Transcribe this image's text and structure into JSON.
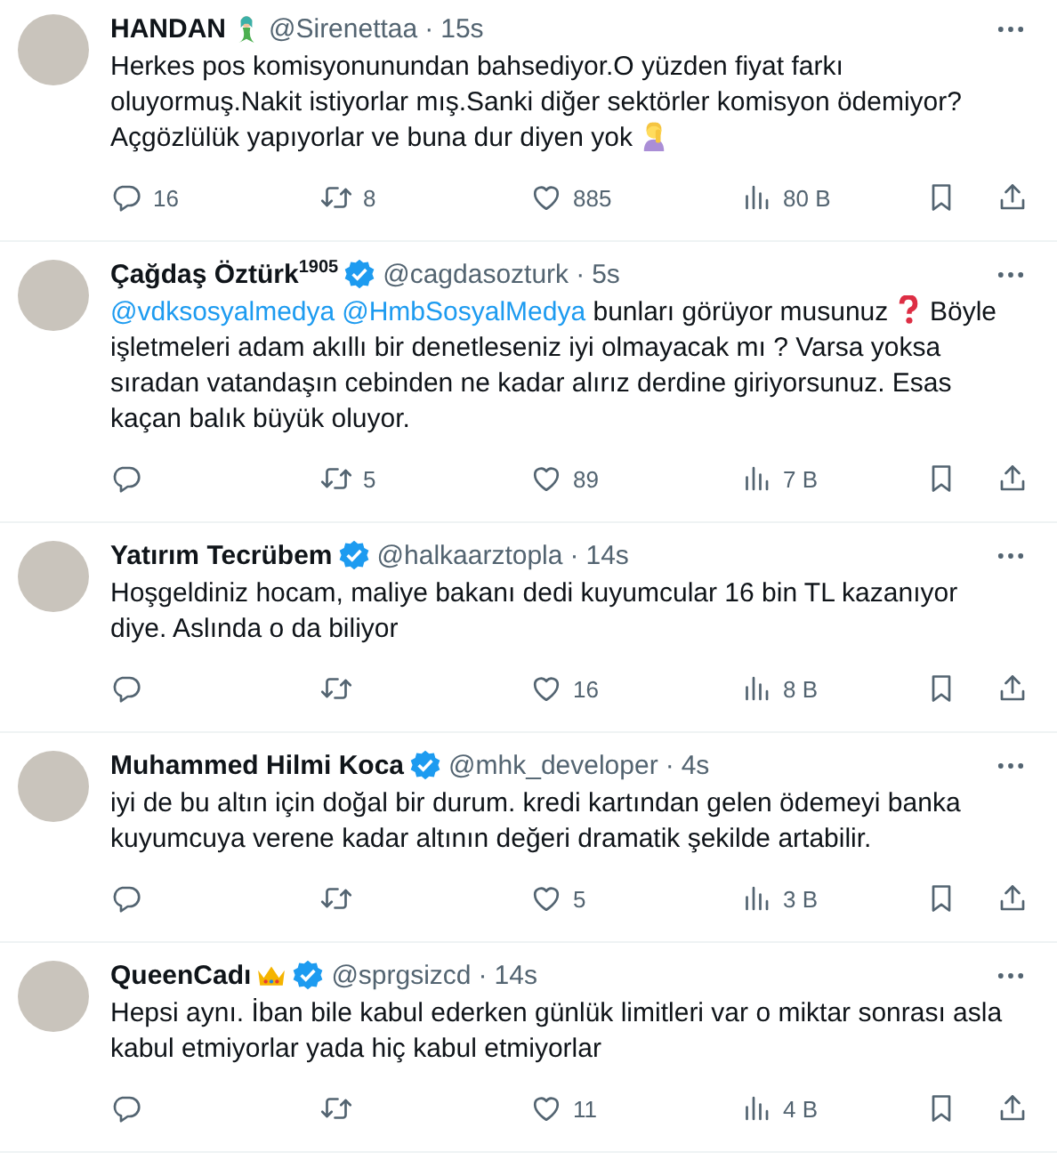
{
  "tweets": [
    {
      "name": "HANDAN",
      "name_emoji": {
        "kind": "mermaid"
      },
      "verified": false,
      "handle": "@Sirenettaa",
      "separator": "·",
      "time": "15s",
      "body": [
        {
          "kind": "text",
          "text": "Herkes pos komisyonunundan bahsediyor.O yüzden fiyat farkı oluyormuş.Nakit istiyorlar mış.Sanki diğer sektörler komisyon ödemiyor? Açgözlülük yapıyorlar ve buna dur diyen yok "
        },
        {
          "kind": "person-emoji"
        }
      ],
      "replies": "16",
      "reposts": "8",
      "likes": "885",
      "views": "80 B"
    },
    {
      "name": "Çağdaş Öztürk$^{1905}$",
      "verified": true,
      "handle": "@cagdasozturk",
      "separator": "·",
      "time": "5s",
      "body": [
        {
          "kind": "mention",
          "text": "@vdksosyalmedya"
        },
        {
          "kind": "mention",
          "text": "@HmbSosyalMedya"
        },
        {
          "kind": "text",
          "text": "  bunları görüyor musunuz "
        },
        {
          "kind": "question-emoji"
        },
        {
          "kind": "text",
          "text": " Böyle işletmeleri adam akıllı bir denetleseniz iyi olmayacak mı ? Varsa yoksa sıradan vatandaşın cebinden ne kadar alırız derdine giriyorsunuz. Esas kaçan balık büyük oluyor."
        }
      ],
      "reposts": "5",
      "likes": "89",
      "views": "7 B"
    },
    {
      "name": "Yatırım Tecrübem",
      "verified": true,
      "handle": "@halkaarztopla",
      "separator": "·",
      "time": "14s",
      "body": [
        {
          "kind": "text",
          "text": "Hoşgeldiniz hocam, maliye bakanı dedi kuyumcular 16 bin TL kazanıyor diye. Aslında o da biliyor"
        }
      ],
      "likes": "16",
      "views": "8 B"
    },
    {
      "name": "Muhammed Hilmi Koca",
      "verified": true,
      "handle": "@mhk_developer",
      "separator": "·",
      "time": "4s",
      "body": [
        {
          "kind": "text",
          "text": "iyi de bu altın için doğal bir durum. kredi kartından gelen ödemeyi banka kuyumcuya verene kadar altının değeri dramatik şekilde artabilir."
        }
      ],
      "likes": "5",
      "views": "3 B"
    },
    {
      "name": "QueenCadı",
      "name_emoji": {
        "kind": "crown"
      },
      "verified": true,
      "handle": "@sprgsizcd",
      "separator": "·",
      "time": "14s",
      "body": [
        {
          "kind": "text",
          "text": "Hepsi aynı. İban bile kabul ederken günlük limitleri var o miktar sonrası asla kabul etmiyorlar yada hiç kabul etmiyorlar"
        }
      ],
      "likes": "11",
      "views": "4 B"
    }
  ]
}
